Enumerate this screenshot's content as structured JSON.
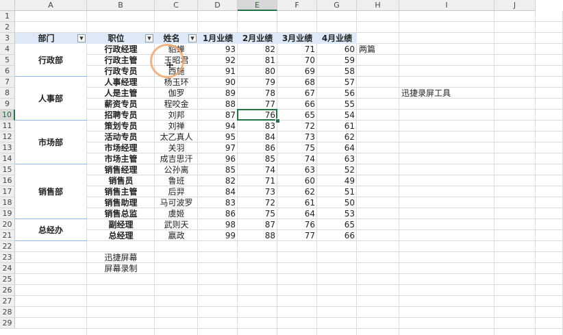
{
  "columns": [
    "A",
    "B",
    "C",
    "D",
    "E",
    "F",
    "G",
    "H",
    "I",
    "J"
  ],
  "selected_column": "E",
  "rows": [
    "1",
    "2",
    "3",
    "4",
    "5",
    "6",
    "7",
    "8",
    "9",
    "10",
    "11",
    "12",
    "13",
    "14",
    "15",
    "16",
    "17",
    "18",
    "19",
    "20",
    "21",
    "22",
    "23",
    "24",
    "25",
    "26",
    "27",
    "28",
    "29"
  ],
  "selected_row": "10",
  "header": {
    "dept": "部门",
    "position": "职位",
    "name": "姓名",
    "q1": "1月业绩",
    "q2": "2月业绩",
    "q3": "3月业绩",
    "q4": "4月业绩",
    "filter_icon": "dropdown-arrow-icon"
  },
  "departments": [
    "行政部",
    "人事部",
    "市场部",
    "销售部",
    "总经办"
  ],
  "records": [
    {
      "position": "行政经理",
      "name": "貂蝉",
      "m1": "93",
      "m2": "82",
      "m3": "71",
      "m4": "60"
    },
    {
      "position": "行政主管",
      "name": "王昭君",
      "m1": "92",
      "m2": "81",
      "m3": "70",
      "m4": "59"
    },
    {
      "position": "行政专员",
      "name": "西施",
      "m1": "91",
      "m2": "80",
      "m3": "69",
      "m4": "58"
    },
    {
      "position": "人事经理",
      "name": "杨玉环",
      "m1": "90",
      "m2": "79",
      "m3": "68",
      "m4": "57"
    },
    {
      "position": "人是主管",
      "name": "伽罗",
      "m1": "89",
      "m2": "78",
      "m3": "67",
      "m4": "56"
    },
    {
      "position": "薪资专员",
      "name": "程咬金",
      "m1": "88",
      "m2": "77",
      "m3": "66",
      "m4": "55"
    },
    {
      "position": "招聘专员",
      "name": "刘邦",
      "m1": "87",
      "m2": "76",
      "m3": "65",
      "m4": "54"
    },
    {
      "position": "策划专员",
      "name": "刘禅",
      "m1": "94",
      "m2": "83",
      "m3": "72",
      "m4": "61"
    },
    {
      "position": "活动专员",
      "name": "太乙真人",
      "m1": "95",
      "m2": "84",
      "m3": "73",
      "m4": "62"
    },
    {
      "position": "市场经理",
      "name": "关羽",
      "m1": "97",
      "m2": "86",
      "m3": "75",
      "m4": "64"
    },
    {
      "position": "市场主管",
      "name": "成吉思汗",
      "m1": "96",
      "m2": "85",
      "m3": "74",
      "m4": "63"
    },
    {
      "position": "销售经理",
      "name": "公孙离",
      "m1": "85",
      "m2": "74",
      "m3": "63",
      "m4": "52"
    },
    {
      "position": "销售员",
      "name": "鲁班",
      "m1": "82",
      "m2": "71",
      "m3": "60",
      "m4": "49"
    },
    {
      "position": "销售主管",
      "name": "后羿",
      "m1": "84",
      "m2": "73",
      "m3": "62",
      "m4": "51"
    },
    {
      "position": "销售助理",
      "name": "马可波罗",
      "m1": "83",
      "m2": "72",
      "m3": "61",
      "m4": "50"
    },
    {
      "position": "销售总监",
      "name": "虞姬",
      "m1": "86",
      "m2": "75",
      "m3": "64",
      "m4": "53"
    },
    {
      "position": "副经理",
      "name": "武则天",
      "m1": "98",
      "m2": "87",
      "m3": "76",
      "m4": "65"
    },
    {
      "position": "总经理",
      "name": "嬴政",
      "m1": "99",
      "m2": "88",
      "m3": "77",
      "m4": "66"
    }
  ],
  "extra": {
    "h4": "两篇",
    "i8": "迅捷录屏工具",
    "b23": "迅捷屏幕",
    "b24": "屏幕录制"
  },
  "colors": {
    "header_fill": "#dde9f7",
    "selection": "#217346",
    "cursor_ring": "#f2a66a"
  }
}
